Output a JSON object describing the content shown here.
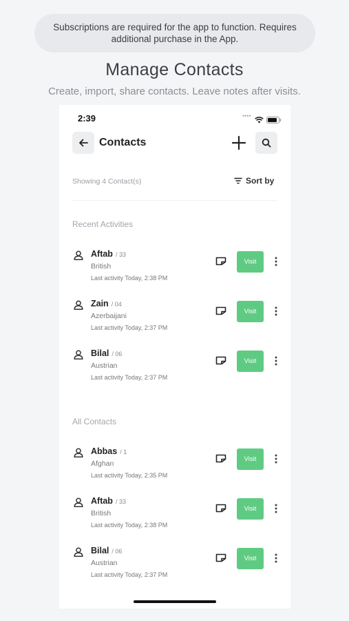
{
  "banner": {
    "text": "Subscriptions are required for the app to function. Requires additional purchase in the App."
  },
  "headline": "Manage Contacts",
  "subline": "Create, import, share contacts. Leave notes after visits.",
  "status_bar": {
    "time": "2:39"
  },
  "header": {
    "title": "Contacts"
  },
  "list_info": {
    "showing": "Showing 4 Contact(s)",
    "sort_label": "Sort by"
  },
  "colors": {
    "visit_button": "#5fcb82",
    "icon_bg": "#eceef0"
  },
  "sections": {
    "recent": {
      "label": "Recent Activities",
      "rows": [
        {
          "name": "Aftab",
          "num": "/ 33",
          "country": "British",
          "activity": "Last activity Today, 2:38 PM",
          "visit": "Visit"
        },
        {
          "name": "Zain",
          "num": "/ 04",
          "country": "Azerbaijani",
          "activity": "Last activity Today, 2:37 PM",
          "visit": "Visit"
        },
        {
          "name": "Bilal",
          "num": "/ 06",
          "country": "Austrian",
          "activity": "Last activity Today, 2:37 PM",
          "visit": "Visit"
        }
      ]
    },
    "all": {
      "label": "All Contacts",
      "rows": [
        {
          "name": "Abbas",
          "num": "/ 1",
          "country": "Afghan",
          "activity": "Last activity Today, 2:35 PM",
          "visit": "Visit"
        },
        {
          "name": "Aftab",
          "num": "/ 33",
          "country": "British",
          "activity": "Last activity Today, 2:38 PM",
          "visit": "Visit"
        },
        {
          "name": "Bilal",
          "num": "/ 06",
          "country": "Austrian",
          "activity": "Last activity Today, 2:37 PM",
          "visit": "Visit"
        }
      ]
    }
  }
}
